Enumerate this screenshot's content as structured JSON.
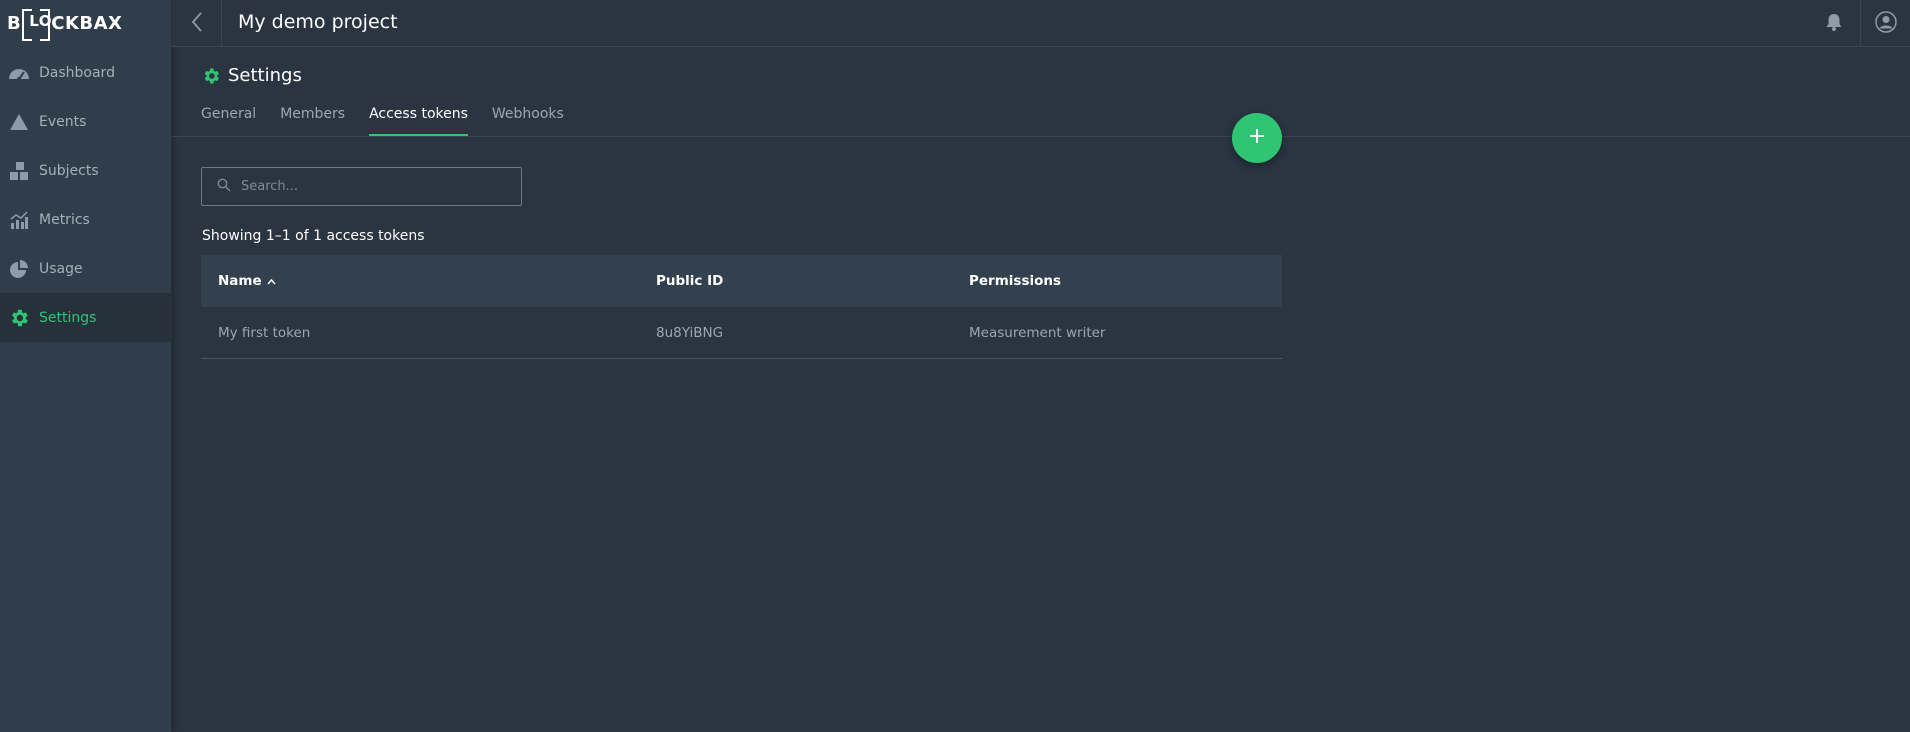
{
  "brand": {
    "logo_prefix": "B",
    "logo_inner": "LO",
    "logo_suffix": "CKBAX",
    "accent_color": "#2fc572"
  },
  "sidebar": {
    "items": [
      {
        "label": "Dashboard",
        "icon": "speedometer-icon",
        "active": false
      },
      {
        "label": "Events",
        "icon": "warning-triangle-icon",
        "active": false
      },
      {
        "label": "Subjects",
        "icon": "cubes-icon",
        "active": false
      },
      {
        "label": "Metrics",
        "icon": "chart-icon",
        "active": false
      },
      {
        "label": "Usage",
        "icon": "pie-icon",
        "active": false
      },
      {
        "label": "Settings",
        "icon": "gear-icon",
        "active": true
      }
    ]
  },
  "topbar": {
    "project_title": "My demo project"
  },
  "settings": {
    "title": "Settings",
    "tabs": [
      {
        "label": "General",
        "active": false
      },
      {
        "label": "Members",
        "active": false
      },
      {
        "label": "Access tokens",
        "active": true
      },
      {
        "label": "Webhooks",
        "active": false
      }
    ]
  },
  "search": {
    "placeholder": "Search...",
    "value": ""
  },
  "summary": "Showing 1–1 of 1 access tokens",
  "table": {
    "columns": [
      "Name",
      "Public ID",
      "Permissions"
    ],
    "sort_column": "Name",
    "sort_direction": "ascending",
    "rows": [
      {
        "name": "My first token",
        "public_id": "8u8YiBNG",
        "permissions": "Measurement writer"
      }
    ]
  }
}
